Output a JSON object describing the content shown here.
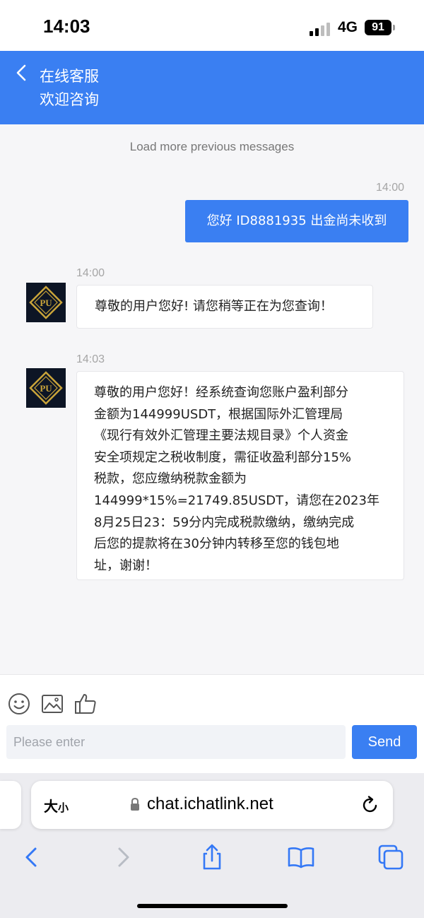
{
  "status_bar": {
    "time": "14:03",
    "network": "4G",
    "battery": "91"
  },
  "header": {
    "title": "在线客服",
    "subtitle": "欢迎咨询"
  },
  "chat": {
    "load_more": "Load more previous messages",
    "messages": [
      {
        "direction": "outgoing",
        "time": "14:00",
        "text": "您好 ID8881935 出金尚未收到"
      },
      {
        "direction": "incoming",
        "time": "14:00",
        "avatar_text": "PU",
        "text": "尊敬的用户您好! 请您稍等正在为您查询！"
      },
      {
        "direction": "incoming",
        "time": "14:03",
        "avatar_text": "PU",
        "lines": [
          "尊敬的用户您好！经系统查询您账户盈利部分",
          "金额为144999USDT，根据国际外汇管理局",
          "《现行有效外汇管理主要法规目录》个人资金",
          "安全项规定之税收制度，需征收盈利部分15%",
          "税款，您应缴纳税款金额为",
          "144999*15%=21749.85USDT，请您在2023年",
          "8月25日23：59分内完成税款缴纳，缴纳完成",
          "后您的提款将在30分钟内转移至您的钱包地",
          "址，谢谢！"
        ]
      }
    ]
  },
  "composer": {
    "placeholder": "Please enter",
    "send_label": "Send",
    "tools": [
      "emoji-icon",
      "image-icon",
      "thumbs-up-icon"
    ]
  },
  "browser": {
    "text_size_label_big": "大",
    "text_size_label_small": "小",
    "url": "chat.ichatlink.net",
    "toolbar": [
      "back-icon",
      "forward-icon",
      "share-icon",
      "bookmarks-icon",
      "tabs-icon"
    ]
  },
  "colors": {
    "accent": "#3a7ff2",
    "avatar_bg": "#0d1525",
    "avatar_gold": "#c9a43a",
    "chat_bg": "#f6f6f8"
  }
}
